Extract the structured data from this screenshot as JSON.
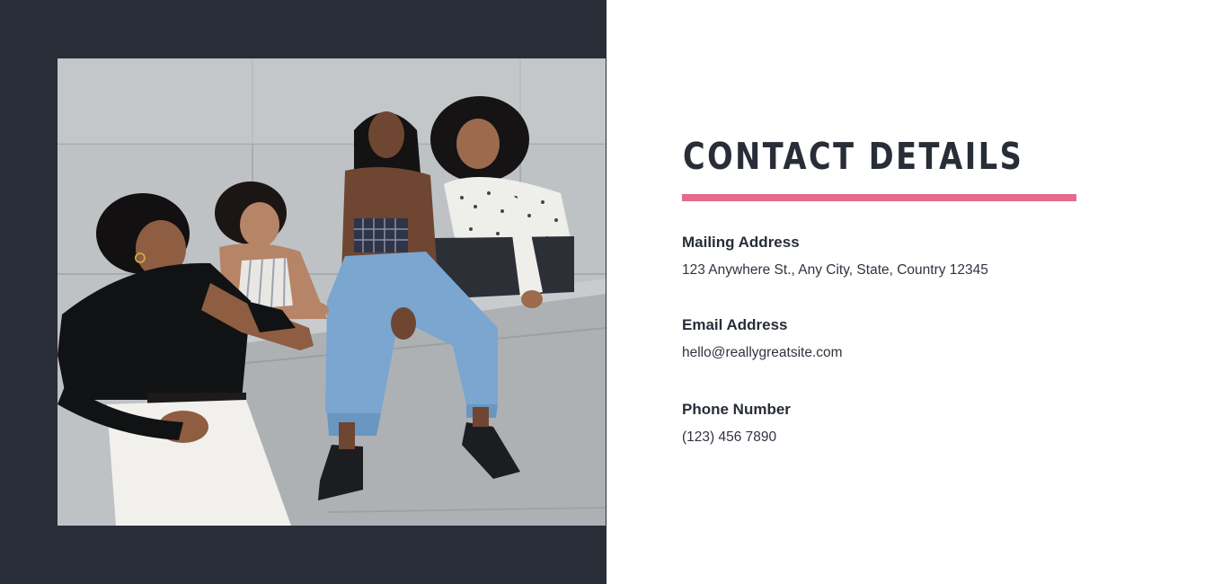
{
  "contact": {
    "title": "CONTACT DETAILS",
    "mailing": {
      "label": "Mailing Address",
      "value": "123 Anywhere St., Any City, State, Country 12345"
    },
    "email": {
      "label": "Email Address",
      "value": "hello@reallygreatsite.com"
    },
    "phone": {
      "label": "Phone Number",
      "value": "(123) 456 7890"
    }
  },
  "colors": {
    "dark_panel": "#282d38",
    "accent_underline": "#e56b8c",
    "text": "#282d38"
  }
}
